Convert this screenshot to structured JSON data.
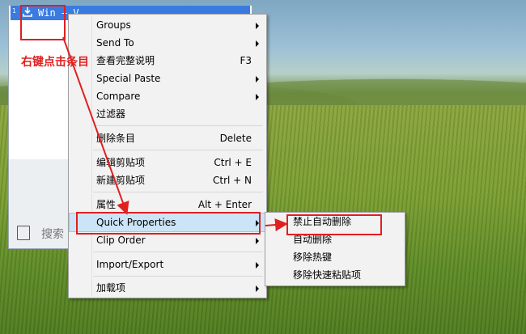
{
  "clip_window": {
    "row": {
      "number": "1",
      "text": "Win + V",
      "icon": "download-icon"
    },
    "search_label": "搜索"
  },
  "context_menu": {
    "items": [
      {
        "label": "Groups",
        "shortcut": "",
        "submenu": true
      },
      {
        "label": "Send To",
        "shortcut": "",
        "submenu": true
      },
      {
        "label": "查看完整说明",
        "shortcut": "F3",
        "submenu": false
      },
      {
        "label": "Special Paste",
        "shortcut": "",
        "submenu": true
      },
      {
        "label": "Compare",
        "shortcut": "",
        "submenu": true
      },
      {
        "label": "过滤器",
        "shortcut": "",
        "submenu": false
      },
      {
        "label": "删除条目",
        "shortcut": "Delete",
        "submenu": false
      },
      {
        "label": "编辑剪贴项",
        "shortcut": "Ctrl + E",
        "submenu": false
      },
      {
        "label": "新建剪贴项",
        "shortcut": "Ctrl + N",
        "submenu": false
      },
      {
        "label": "属性",
        "shortcut": "Alt + Enter",
        "submenu": false
      },
      {
        "label": "Quick Properties",
        "shortcut": "",
        "submenu": true,
        "highlighted": true
      },
      {
        "label": "Clip Order",
        "shortcut": "",
        "submenu": true
      },
      {
        "label": "Import/Export",
        "shortcut": "",
        "submenu": true
      },
      {
        "label": "加载项",
        "shortcut": "",
        "submenu": true
      }
    ]
  },
  "quick_properties_submenu": {
    "items": [
      {
        "label": "禁止自动删除"
      },
      {
        "label": "自动删除"
      },
      {
        "label": "移除热键"
      },
      {
        "label": "移除快速粘贴项"
      }
    ]
  },
  "annotation": {
    "text": "右键点击条目",
    "color": "#e02020"
  },
  "colors": {
    "selection": "#3a7be0",
    "menu_highlight": "#cce4f7"
  }
}
